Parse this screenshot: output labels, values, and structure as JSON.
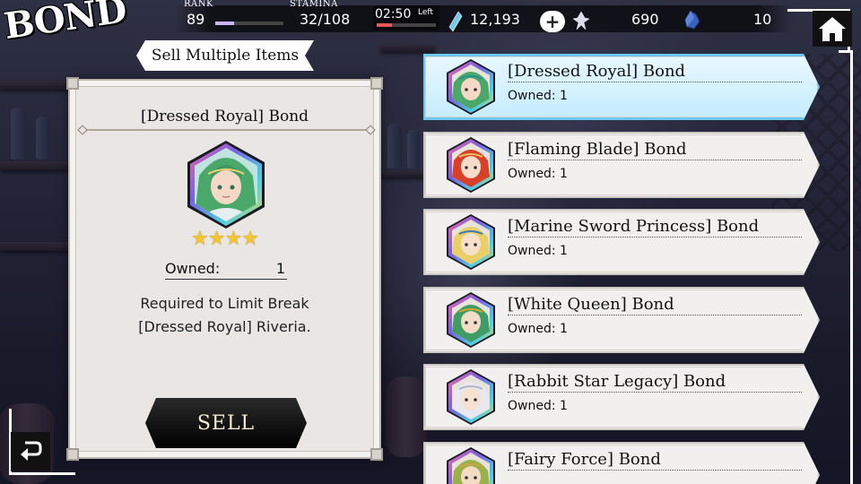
{
  "screen_title": "BOND",
  "status_bar": {
    "rank_label": "RANK",
    "rank_value": "89",
    "rank_progress": 0.28,
    "stamina_label": "STAMINA",
    "stamina_value": "32/108",
    "timer_value": "02:50",
    "timer_suffix": "Left",
    "timer_progress": 0.25,
    "currency_1": "12,193",
    "currency_2": "690",
    "currency_3": "10",
    "colors": {
      "rank_bar": "#c7b6f2",
      "timer_bar": "#e25a5a"
    }
  },
  "sell_multiple_label": "Sell Multiple Items",
  "detail": {
    "title": "[Dressed Royal] Bond",
    "stars": "★★★★",
    "star_count": 4,
    "owned_label": "Owned:",
    "owned_value": "1",
    "description_line1": "Required to Limit Break",
    "description_line2": "[Dressed Royal] Riveria.",
    "sell_button": "SELL"
  },
  "icons": {
    "home": "home-icon",
    "back": "back-arrow-icon",
    "crystal": "crystal-icon",
    "plus": "plus-icon"
  },
  "items": [
    {
      "name": "[Dressed Royal] Bond",
      "owned": "Owned: 1",
      "selected": true,
      "hair": "#4aa86a",
      "skin": "#f4d9c6",
      "accent": "#2b8f8a"
    },
    {
      "name": "[Flaming Blade] Bond",
      "owned": "Owned: 1",
      "selected": false,
      "hair": "#d8402a",
      "skin": "#f6dccb",
      "accent": "#e8c25a"
    },
    {
      "name": "[Marine Sword Princess] Bond",
      "owned": "Owned: 1",
      "selected": false,
      "hair": "#e8cf68",
      "skin": "#f6e0cc",
      "accent": "#3a7ab8"
    },
    {
      "name": "[White Queen] Bond",
      "owned": "Owned: 1",
      "selected": false,
      "hair": "#3f9c64",
      "skin": "#f3dcc8",
      "accent": "#d4a62a"
    },
    {
      "name": "[Rabbit Star Legacy] Bond",
      "owned": "Owned: 1",
      "selected": false,
      "hair": "#e8e8ee",
      "skin": "#f6e2d0",
      "accent": "#b0b4c8"
    },
    {
      "name": "[Fairy Force] Bond",
      "owned": "",
      "selected": false,
      "hair": "#9ab04a",
      "skin": "#f2dcc6",
      "accent": "#c9a640"
    }
  ]
}
